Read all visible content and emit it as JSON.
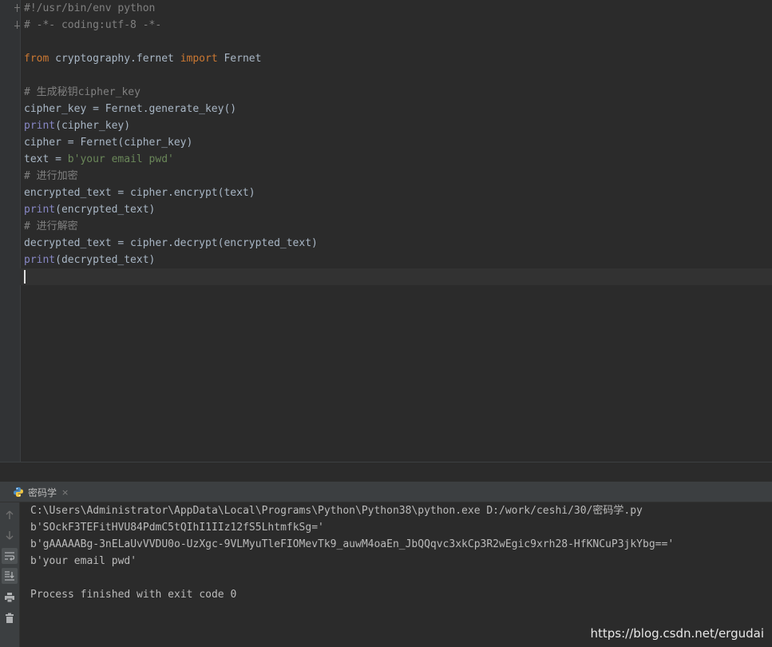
{
  "editor": {
    "code_lines": [
      [
        {
          "t": "#!/usr/bin/env python",
          "c": "c"
        }
      ],
      [
        {
          "t": "# -*- coding:utf-8 -*-",
          "c": "c"
        }
      ],
      [],
      [
        {
          "t": "from",
          "c": "k"
        },
        {
          "t": " cryptography.fernet "
        },
        {
          "t": "import",
          "c": "k"
        },
        {
          "t": " Fernet"
        }
      ],
      [],
      [
        {
          "t": "# 生成秘钥cipher_key",
          "c": "c"
        }
      ],
      [
        {
          "t": "cipher_key = Fernet.generate_key()"
        }
      ],
      [
        {
          "t": "print",
          "c": "b"
        },
        {
          "t": "(cipher_key)"
        }
      ],
      [
        {
          "t": "cipher = Fernet(cipher_key)"
        }
      ],
      [
        {
          "t": "text = "
        },
        {
          "t": "b'your email pwd'",
          "c": "s"
        }
      ],
      [
        {
          "t": "# 进行加密",
          "c": "c"
        }
      ],
      [
        {
          "t": "encrypted_text = cipher.encrypt(text)"
        }
      ],
      [
        {
          "t": "print",
          "c": "b"
        },
        {
          "t": "(encrypted_text)"
        }
      ],
      [
        {
          "t": "# 进行解密",
          "c": "c"
        }
      ],
      [
        {
          "t": "decrypted_text = cipher.decrypt(encrypted_text)"
        }
      ],
      [
        {
          "t": "print",
          "c": "b"
        },
        {
          "t": "(decrypted_text)"
        }
      ],
      []
    ],
    "current_line": 16
  },
  "run_panel": {
    "tab_label": "密码学",
    "close_glyph": "×",
    "toolbar_icons": [
      "arrow-up-icon",
      "arrow-down-icon",
      "soft-wrap-icon",
      "scroll-to-end-icon",
      "print-icon",
      "trash-icon"
    ],
    "active_toolbar": [
      2,
      3
    ],
    "output_lines": [
      "C:\\Users\\Administrator\\AppData\\Local\\Programs\\Python\\Python38\\python.exe D:/work/ceshi/30/密码学.py",
      "b'SOckF3TEFitHVU84PdmC5tQIhI1IIz12fS5LhtmfkSg='",
      "b'gAAAAABg-3nELaUvVVDU0o-UzXgc-9VLMyuTleFIOMevTk9_auwM4oaEn_JbQQqvc3xkCp3R2wEgic9xrh28-HfKNCuP3jkYbg=='",
      "b'your email pwd'",
      "",
      "Process finished with exit code 0"
    ]
  },
  "watermark": "https://blog.csdn.net/ergudai"
}
